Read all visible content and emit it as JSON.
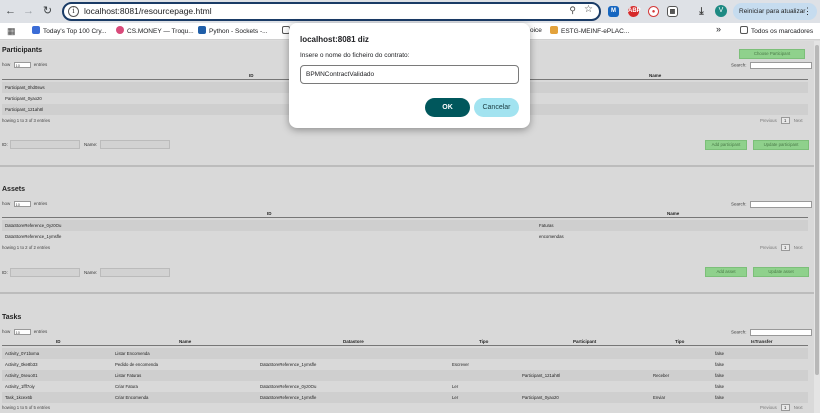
{
  "browser": {
    "url": "localhost:8081/resourcepage.html",
    "update_button": "Reiniciar para atualizar",
    "avatar_letter": "V",
    "bookmarks": [
      {
        "label": "Today's Top 100 Cry...",
        "color": "#3b6cd6"
      },
      {
        "label": "CS.MONEY — Troqu...",
        "color": "#d94a7a"
      },
      {
        "label": "Python - Sockets -...",
        "color": "#1f5ea8"
      },
      {
        "label": "oice",
        "color": "#ffffff"
      },
      {
        "label": "ESTG-MEINF-ePLAC...",
        "color": "#e3a23b"
      }
    ],
    "all_bookmarks": "Todos os marcadores",
    "overflow": "»"
  },
  "dialog": {
    "title": "localhost:8081 diz",
    "message": "Insere o nome do ficheiro do contrato:",
    "input_value": "BPMNContractValidado",
    "ok_label": "OK",
    "cancel_label": "Cancelar"
  },
  "participants": {
    "title": "Participants",
    "show": "how",
    "entries_value": "10",
    "entries": "entries",
    "search": "Search:",
    "columns": [
      "ID",
      "Name"
    ],
    "rows": [
      [
        "Participant_0hd0sws",
        ""
      ],
      [
        "Participant_0yao20",
        ""
      ],
      [
        "Participant_121ah8l",
        ""
      ]
    ],
    "info": "howing 1 to 3 of 3 entries",
    "previous": "Previous",
    "page": "1",
    "next": "Next",
    "id_label": "ID:",
    "name_label": "Name:",
    "add_button": "Add participant",
    "update_button": "Update participant",
    "top_button": "Choose Participant"
  },
  "assets": {
    "title": "Assets",
    "show": "how",
    "entries_value": "10",
    "entries": "entries",
    "search": "Search:",
    "columns": [
      "ID",
      "Name"
    ],
    "rows": [
      [
        "DataStoreReference_0yz0Ou",
        "Faturas"
      ],
      [
        "DataStoreReference_1ymsfle",
        "encomendas"
      ]
    ],
    "info": "howing 1 to 2 of 2 entries",
    "previous": "Previous",
    "page": "1",
    "next": "Next",
    "id_label": "ID:",
    "name_label": "Name:",
    "add_button": "Add asset",
    "update_button": "Update asset"
  },
  "tasks": {
    "title": "Tasks",
    "show": "how",
    "entries_value": "10",
    "entries": "entries",
    "search": "Search:",
    "columns": [
      "ID",
      "Name",
      "Datastore",
      "Tipo",
      "Participant",
      "Tipo",
      "IsTransfer"
    ],
    "rows": [
      [
        "Activity_0Y1bxma",
        "Listar Encomenda",
        "",
        "",
        "",
        "",
        "false"
      ],
      [
        "Activity_0ke8b33",
        "Pedido de encomenda",
        "DataStoreReference_1ymsfle",
        "Escrever",
        "",
        "",
        "false"
      ],
      [
        "Activity_0seuo01",
        "Listar Faturas",
        "",
        "",
        "Participant_121ah8l",
        "Receber",
        "false"
      ],
      [
        "Activity_1fff7oiy",
        "Criar Fatura",
        "DataStoreReference_0yz0Ou",
        "Ler",
        "",
        "",
        "false"
      ],
      [
        "Task_1kcex6b",
        "Criar Encomenda",
        "DataStoreReference_1ymsfle",
        "Ler",
        "Participant_0yao20",
        "Enviar",
        "false"
      ]
    ],
    "info": "howing 1 to 5 of 5 entries",
    "previous": "Previous",
    "page": "1",
    "next": "Next"
  }
}
